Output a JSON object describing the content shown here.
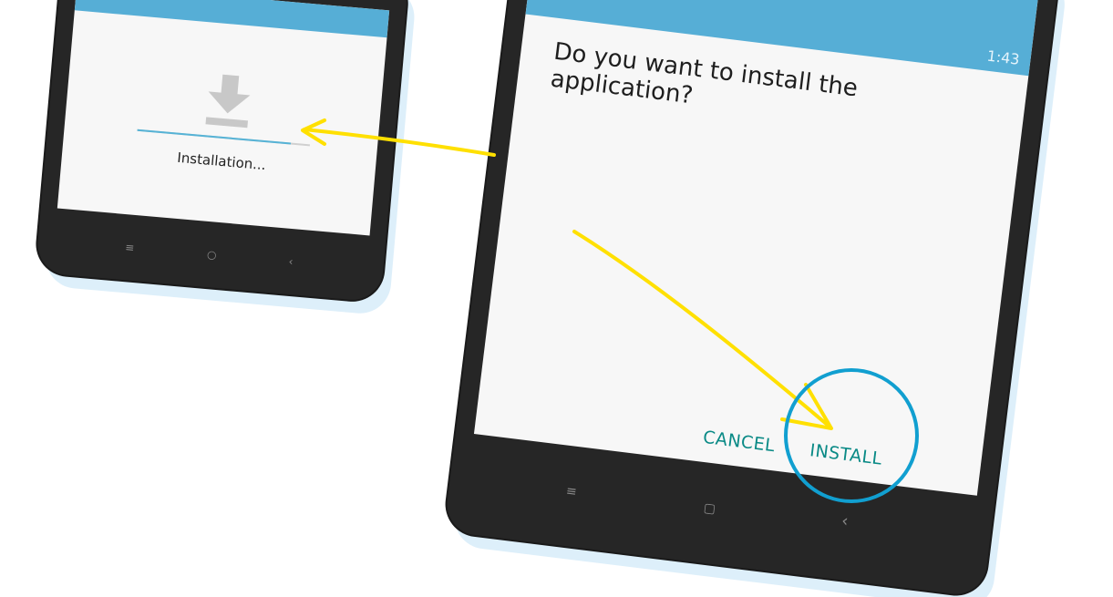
{
  "left_screen": {
    "status": "Installation...",
    "progress": 0.89,
    "icon": "download-icon"
  },
  "right_screen": {
    "status_time": "1:43",
    "question": "Do you want to install the application?",
    "cancel_label": "CANCEL",
    "install_label": "INSTALL"
  },
  "nav_icons": [
    "menu-icon",
    "home-icon",
    "back-icon"
  ],
  "colors": {
    "status_bar": "#56aed6",
    "button_text": "#0a8a86",
    "highlight_circle": "#119fd0",
    "annotation_arrow": "#ffe000"
  }
}
